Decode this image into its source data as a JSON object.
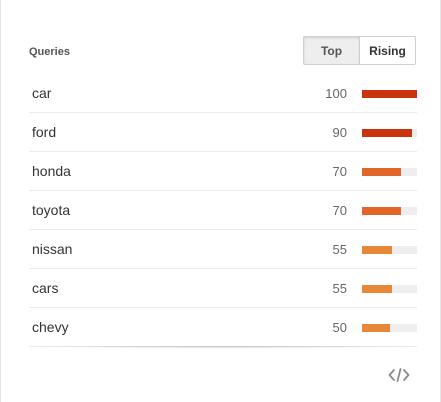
{
  "header": {
    "title": "Queries"
  },
  "toggle": {
    "top_label": "Top",
    "rising_label": "Rising",
    "selected": "Top"
  },
  "queries": [
    {
      "label": "car",
      "value": "100",
      "percent": 100,
      "color": "#c9340f"
    },
    {
      "label": "ford",
      "value": "90",
      "percent": 90,
      "color": "#c9340f"
    },
    {
      "label": "honda",
      "value": "70",
      "percent": 70,
      "color": "#e0662a"
    },
    {
      "label": "toyota",
      "value": "70",
      "percent": 70,
      "color": "#e0662a"
    },
    {
      "label": "nissan",
      "value": "55",
      "percent": 55,
      "color": "#e88738"
    },
    {
      "label": "cars",
      "value": "55",
      "percent": 55,
      "color": "#e88738"
    },
    {
      "label": "chevy",
      "value": "50",
      "percent": 50,
      "color": "#e88738"
    }
  ],
  "footer": {
    "embed_icon": "code-embed-icon"
  }
}
